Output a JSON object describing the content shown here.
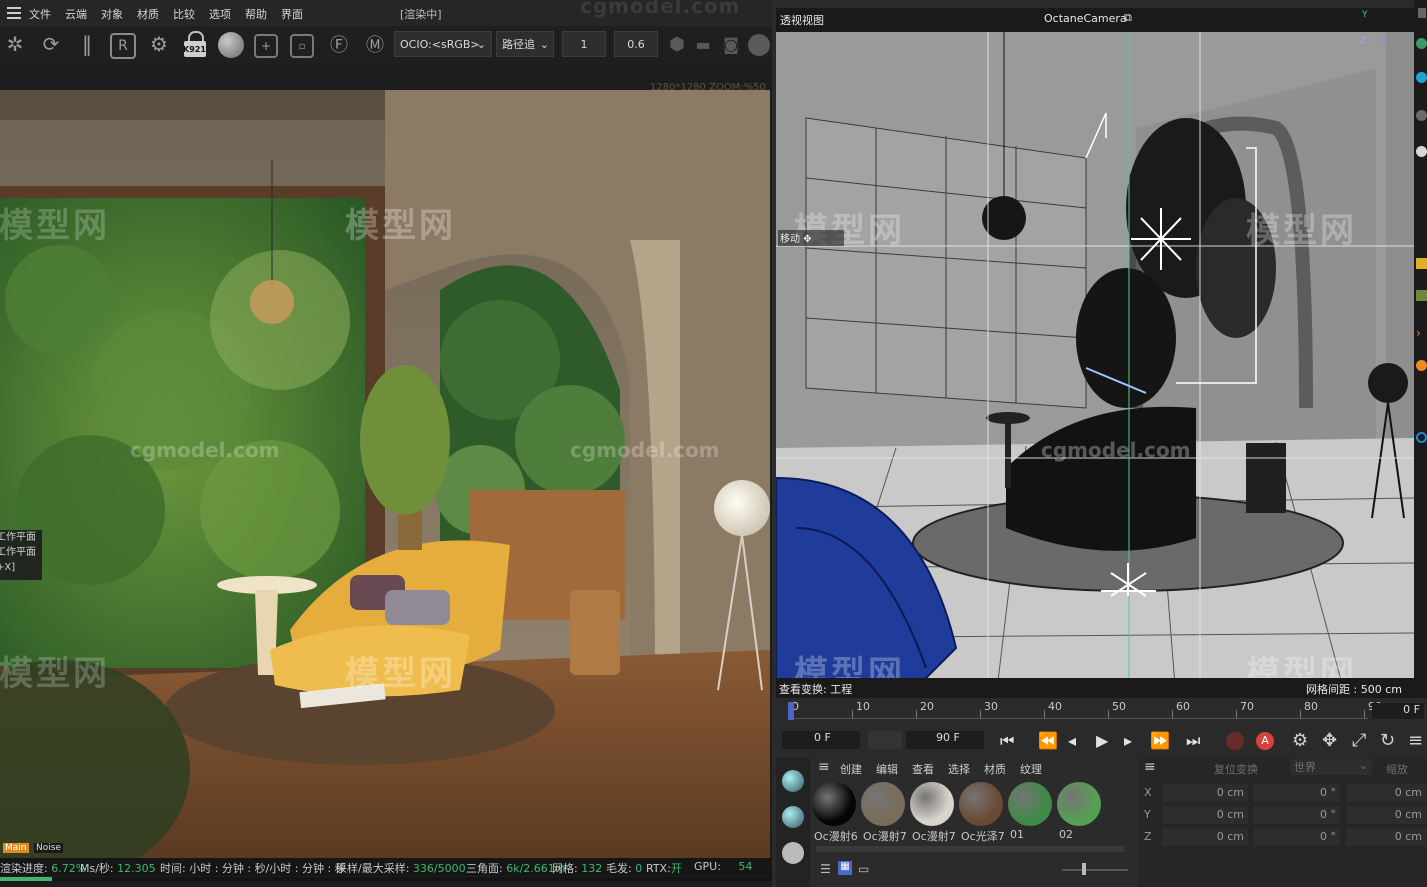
{
  "menubar": {
    "items": [
      "文件",
      "云端",
      "对象",
      "材质",
      "比较",
      "选项",
      "帮助",
      "界面"
    ],
    "status": "[渲染中]"
  },
  "toolbar": {
    "badge": "K921",
    "ocio": "OCIO:<sRGB>",
    "mode": "路径追",
    "value1": "1",
    "value2": "0.6"
  },
  "render": {
    "resolution": "1280*1280 ZOOM:%50",
    "watermark_top": "cgmodel.com",
    "watermark_logo": "模型网",
    "watermark_site": "cgmodel.com",
    "overlay": [
      "工作平面",
      "工作平面",
      "+X]"
    ],
    "tab_main": "Main",
    "tab_noise": "Noise"
  },
  "status": {
    "progress_label": "渲染进度:",
    "progress_value": "6.72%",
    "ms_label": "Ms/秒:",
    "ms_value": "12.305",
    "time": "时间: 小时 : 分钟 : 秒/小时 : 分钟 : 秒",
    "samples_label": "采样/最大采样:",
    "samples_value": "336/5000",
    "tri_label": "三角面:",
    "tri_value": "6k/2.661m",
    "mesh_label": "网格:",
    "mesh_value": "132",
    "hair_label": "毛发:",
    "hair_value": "0",
    "rtx_label": "RTX:",
    "rtx_value": "开",
    "gpu_label": "GPU:",
    "gpu_value": "54",
    "progress_fraction": 0.0672
  },
  "viewport": {
    "title": "透视视图",
    "camera": "OctaneCamera",
    "move_label": "移动",
    "view_transform": "查看变换: 工程",
    "grid_spacing": "网格间距 : 500 cm",
    "axis_y": "Y",
    "axis_z": "Z",
    "axis_x": "X"
  },
  "timeline": {
    "ticks": [
      "0",
      "10",
      "20",
      "30",
      "40",
      "50",
      "60",
      "70",
      "80",
      "90"
    ],
    "current_frame": "0 F",
    "start": "0 F",
    "end": "90 F",
    "playhead": 0
  },
  "materials": {
    "menu": [
      "创建",
      "编辑",
      "查看",
      "选择",
      "材质",
      "纹理"
    ],
    "items": [
      {
        "label": "Oc漫射6",
        "color": "#050505"
      },
      {
        "label": "Oc漫射7",
        "color": "#7a6c5a"
      },
      {
        "label": "Oc漫射7",
        "color": "#d8d4cc"
      },
      {
        "label": "Oc光泽7",
        "color": "#6a4a34"
      },
      {
        "label": "01",
        "color": "#3f8a46"
      },
      {
        "label": "02",
        "color": "#55a052"
      }
    ]
  },
  "coords": {
    "header": [
      "复位变换",
      "世界",
      "缩放"
    ],
    "rows": [
      {
        "axis": "X",
        "pos": "0 cm",
        "rot": "0 °",
        "scale": "0 cm"
      },
      {
        "axis": "Y",
        "pos": "0 cm",
        "rot": "0 °",
        "scale": "0 cm"
      },
      {
        "axis": "Z",
        "pos": "0 cm",
        "rot": "0 °",
        "scale": "0 cm"
      }
    ]
  }
}
